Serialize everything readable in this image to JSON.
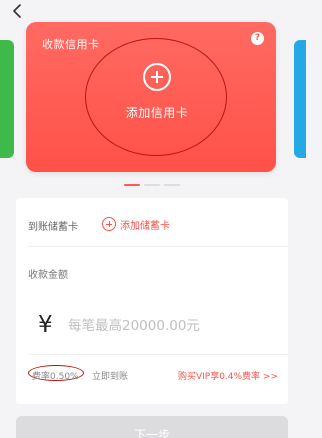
{
  "nav": {
    "back_icon": "chevron-left-icon"
  },
  "credit_card": {
    "title": "收款信用卡",
    "help_icon": "question-icon",
    "help_glyph": "?",
    "add_label": "添加信用卡",
    "add_icon": "plus-circle-icon",
    "accent_color": "#ff5148"
  },
  "carousel": {
    "page_count": 3,
    "active_index": 0,
    "side_colors": [
      "#3fb94a",
      "#24a9e6"
    ]
  },
  "debit": {
    "label": "到账储蓄卡",
    "add_label": "添加储蓄卡",
    "add_icon": "plus-circle-icon"
  },
  "amount": {
    "label": "收款金额",
    "currency_symbol": "¥",
    "placeholder": "每笔最高20000.00元"
  },
  "fee": {
    "rate_text": "费率0.50%",
    "instant_text": "立即到账",
    "vip_link": "购买VIP享0.4%费率 >>"
  },
  "actions": {
    "next_label": "下一步"
  }
}
